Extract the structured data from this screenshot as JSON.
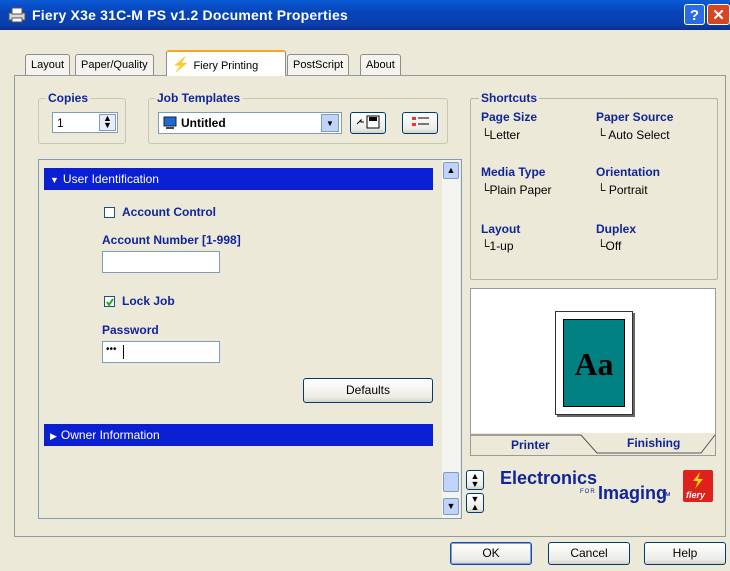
{
  "window": {
    "title": "Fiery X3e 31C-M PS v1.2 Document Properties",
    "help_label": "?",
    "close_label": "✕"
  },
  "tabs": [
    {
      "label": "Layout"
    },
    {
      "label": "Paper/Quality"
    },
    {
      "label": "Fiery Printing"
    },
    {
      "label": "PostScript"
    },
    {
      "label": "About"
    }
  ],
  "copies": {
    "label": "Copies",
    "value": "1"
  },
  "job_templates": {
    "label": "Job Templates",
    "value": "Untitled"
  },
  "sections": {
    "user_identification": "User Identification",
    "owner_information": "Owner Information"
  },
  "user_id": {
    "account_control_label": "Account Control",
    "account_control_checked": false,
    "account_number_label": "Account Number [1-998]",
    "account_number_value": "",
    "lock_job_label": "Lock Job",
    "lock_job_checked": true,
    "password_label": "Password",
    "password_value": "•••",
    "defaults_label": "Defaults"
  },
  "shortcuts": {
    "title": "Shortcuts",
    "items": [
      {
        "label": "Page Size",
        "value": "Letter"
      },
      {
        "label": "Paper Source",
        "value": "Auto Select"
      },
      {
        "label": "Media Type",
        "value": "Plain Paper"
      },
      {
        "label": "Orientation",
        "value": "Portrait"
      },
      {
        "label": "Layout",
        "value": "1-up"
      },
      {
        "label": "Duplex",
        "value": "Off"
      }
    ]
  },
  "preview": {
    "page_text": "Aa",
    "tab_printer": "Printer",
    "tab_finishing": "Finishing",
    "page_color": "#008080"
  },
  "brand": {
    "name": "Electronics",
    "for": "FOR",
    "imaging": "Imaging",
    "tm": "™",
    "logo_text": "fiery"
  },
  "buttons": {
    "ok": "OK",
    "cancel": "Cancel",
    "help": "Help"
  },
  "colors": {
    "accent_blue": "#0b1fd2",
    "label_blue": "#10249c",
    "fiery_red": "#e0201b"
  }
}
